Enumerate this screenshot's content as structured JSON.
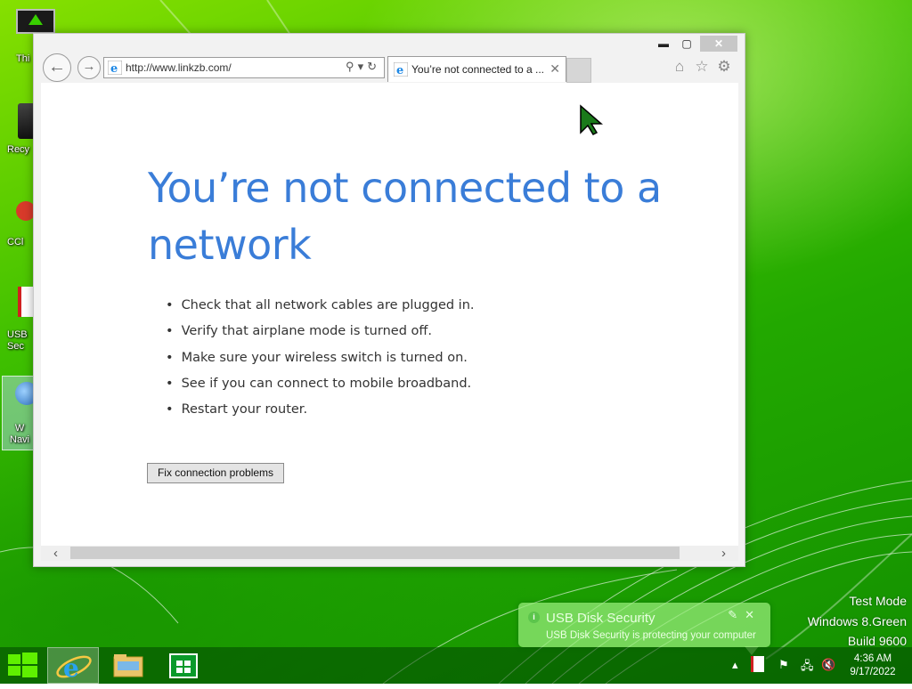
{
  "desktop": {
    "icons": [
      {
        "label": "Thi"
      },
      {
        "label": "Recy"
      },
      {
        "label": "CCl"
      },
      {
        "label": "USB\nSec"
      },
      {
        "label": "W\nNavi"
      }
    ]
  },
  "browser": {
    "address_url": "http://www.linkzb.com/",
    "tab_title": "You’re not connected to a ...",
    "caption_min": "▬",
    "caption_max": "▢",
    "caption_close": "✕"
  },
  "page": {
    "headline": "You’re not connected to a network",
    "tips": [
      "Check that all network cables are plugged in.",
      "Verify that airplane mode is turned off.",
      "Make sure your wireless switch is turned on.",
      "See if you can connect to mobile broadband.",
      "Restart your router."
    ],
    "fix_button": "Fix connection problems"
  },
  "watermark": {
    "line1": "Test Mode",
    "line2": "Windows 8.Green",
    "line3": "Build 9600"
  },
  "notification": {
    "title": "USB Disk Security",
    "message": "USB Disk Security is protecting your computer"
  },
  "taskbar": {
    "clock_time": "4:36 AM",
    "clock_date": "9/17/2022"
  },
  "colors": {
    "headline": "#3a7dd8",
    "desktop_green": "#3fc000"
  }
}
